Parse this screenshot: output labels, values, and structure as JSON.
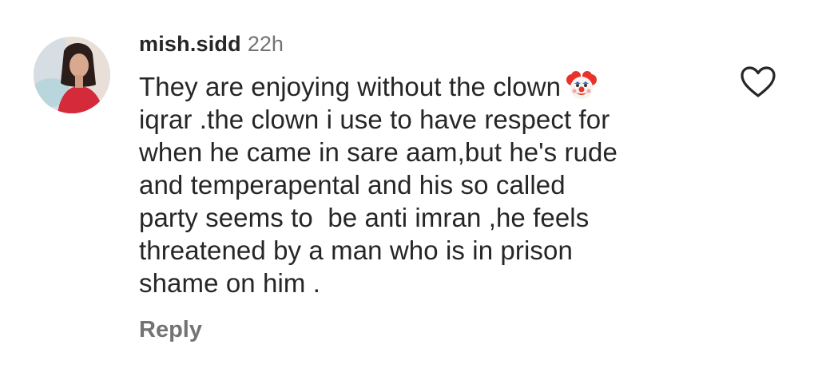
{
  "comment": {
    "username": "mish.sidd",
    "timestamp": "22h",
    "lines": [
      "They are enjoying without the clown",
      "iqrar .the clown i use to have respect for",
      "when he came in sare aam,but he's rude",
      "and temperapental and his so called",
      "party seems to  be anti imran ,he feels",
      "threatened by a man who is in prison",
      "shame on him ."
    ],
    "emoji": "clown-face",
    "reply_label": "Reply",
    "like_icon": "heart-outline-icon"
  },
  "colors": {
    "text": "#262626",
    "secondary": "#737373",
    "background": "#ffffff"
  }
}
